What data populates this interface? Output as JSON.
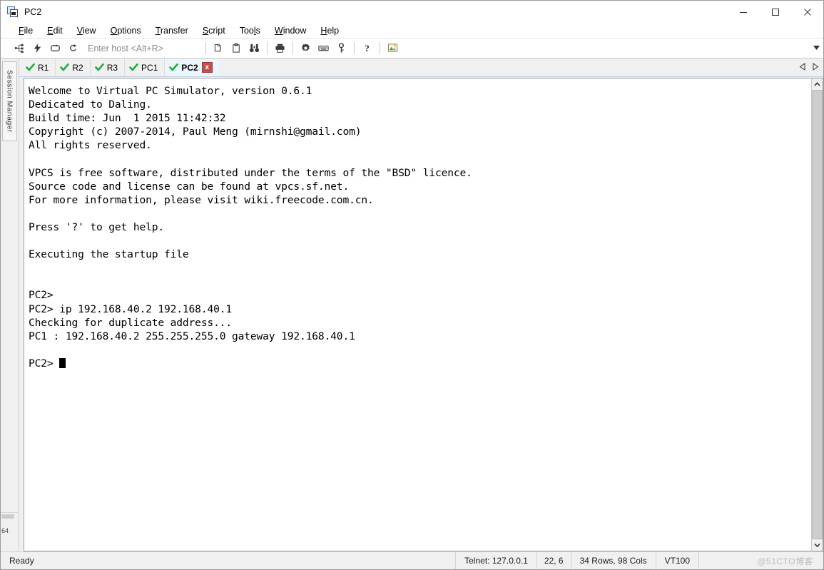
{
  "window": {
    "title": "PC2",
    "icon": "window-stack-icon",
    "controls": {
      "minimize": "minimize-icon",
      "maximize": "maximize-icon",
      "close": "close-icon"
    }
  },
  "menubar": {
    "items": [
      {
        "label": "File",
        "accel": "F"
      },
      {
        "label": "Edit",
        "accel": "E"
      },
      {
        "label": "View",
        "accel": "V"
      },
      {
        "label": "Options",
        "accel": "O"
      },
      {
        "label": "Transfer",
        "accel": "T"
      },
      {
        "label": "Script",
        "accel": "S"
      },
      {
        "label": "Tools",
        "accel": "l"
      },
      {
        "label": "Window",
        "accel": "W"
      },
      {
        "label": "Help",
        "accel": "H"
      }
    ]
  },
  "toolbar": {
    "host_placeholder": "Enter host <Alt+R>",
    "icons_left": [
      "connect-icon",
      "quick-connect-icon",
      "reconnect-icon",
      "reconnect-all-icon"
    ],
    "icons_right": [
      "copy-icon",
      "paste-icon",
      "find-icon",
      "print-icon",
      "settings-gear-icon",
      "keyboard-icon",
      "key-icon",
      "help-icon",
      "session-options-icon"
    ],
    "dropdown": "chevron-down-icon"
  },
  "session_panel": {
    "label": "Session Manager",
    "bottom_label": "64"
  },
  "tabs": {
    "items": [
      {
        "label": "R1",
        "active": false,
        "status": "connected"
      },
      {
        "label": "R2",
        "active": false,
        "status": "connected"
      },
      {
        "label": "R3",
        "active": false,
        "status": "connected"
      },
      {
        "label": "PC1",
        "active": false,
        "status": "connected"
      },
      {
        "label": "PC2",
        "active": true,
        "status": "connected"
      }
    ],
    "close_label": "x",
    "nav_prev": "nav-left-icon",
    "nav_next": "nav-right-icon"
  },
  "terminal": {
    "lines": [
      "Welcome to Virtual PC Simulator, version 0.6.1",
      "Dedicated to Daling.",
      "Build time: Jun  1 2015 11:42:32",
      "Copyright (c) 2007-2014, Paul Meng (mirnshi@gmail.com)",
      "All rights reserved.",
      "",
      "VPCS is free software, distributed under the terms of the \"BSD\" licence.",
      "Source code and license can be found at vpcs.sf.net.",
      "For more information, please visit wiki.freecode.com.cn.",
      "",
      "Press '?' to get help.",
      "",
      "Executing the startup file",
      "",
      "",
      "PC2>",
      "PC2> ip 192.168.40.2 192.168.40.1",
      "Checking for duplicate address...",
      "PC1 : 192.168.40.2 255.255.255.0 gateway 192.168.40.1",
      "",
      "PC2> "
    ],
    "prompt_has_cursor": true
  },
  "scrollbar": {
    "up": "scroll-up-icon",
    "down": "scroll-down-icon"
  },
  "statusbar": {
    "ready": "Ready",
    "connection": "Telnet: 127.0.0.1",
    "cursor_pos": "22,  6",
    "dimensions": "34 Rows, 98 Cols",
    "emulation": "VT100",
    "watermark": "@51CTO博客"
  },
  "colors": {
    "tab_active_bg": "#ecf5fc",
    "check_green": "#1faa42",
    "close_red": "#c0504d",
    "terminal_bg": "#ffffff",
    "chrome_bg": "#f0f0f0"
  }
}
